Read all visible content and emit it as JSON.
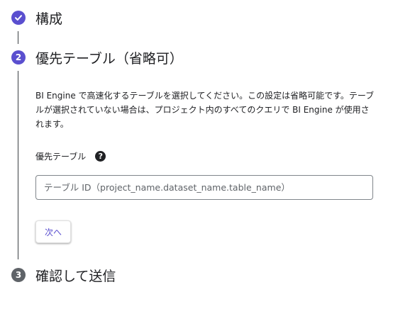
{
  "steps": [
    {
      "number": "1",
      "icon": "check-icon",
      "title": "構成",
      "status": "completed"
    },
    {
      "number": "2",
      "title": "優先テーブル（省略可）",
      "status": "active"
    },
    {
      "number": "3",
      "title": "確認して送信",
      "status": "pending"
    }
  ],
  "step2": {
    "description": "BI Engine で高速化するテーブルを選択してください。この設定は省略可能です。テーブルが選択されていない場合は、プロジェクト内のすべてのクエリで BI Engine が使用されます。",
    "field_label": "優先テーブル",
    "help_icon": "?",
    "input_value": "",
    "input_placeholder": "テーブル ID（project_name.dataset_name.table_name）",
    "next_button_label": "次へ"
  },
  "colors": {
    "accent": "#5a4fcf",
    "pending_step": "#5f6368"
  }
}
